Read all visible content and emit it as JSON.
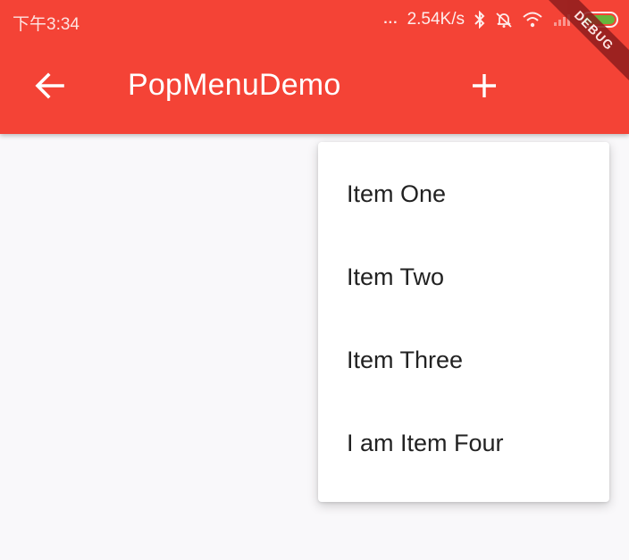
{
  "status_bar": {
    "time": "下午3:34",
    "dots": "...",
    "network_speed": "2.54K/s",
    "icons": [
      "bluetooth-icon",
      "alarm-muted-icon",
      "wifi-icon",
      "signal-icon",
      "battery-icon"
    ],
    "battery_color": "#58c23c"
  },
  "app_bar": {
    "title": "PopMenuDemo",
    "color": "#f44336",
    "back_icon": "arrow-back-icon",
    "action_icon": "add-icon"
  },
  "debug_banner": "DEBUG",
  "popup_menu": {
    "items": [
      {
        "label": "Item One"
      },
      {
        "label": "Item Two"
      },
      {
        "label": "Item Three"
      },
      {
        "label": "I am Item Four"
      }
    ]
  }
}
